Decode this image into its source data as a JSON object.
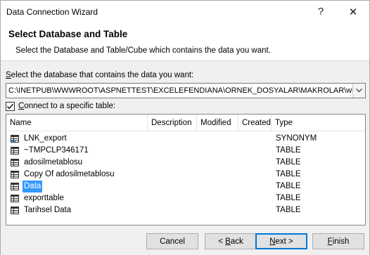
{
  "window": {
    "title": "Data Connection Wizard",
    "help_glyph": "?",
    "close_glyph": "✕"
  },
  "header": {
    "title": "Select Database and Table",
    "subtitle": "Select the Database and Table/Cube which contains the data you want."
  },
  "database": {
    "label_underlined": "S",
    "label_rest": "elect the database that contains the data you want:",
    "value": "C:\\INETPUB\\WWWROOT\\ASPNETTEST\\EXCELEFENDIANA\\ORNEK_DOSYALAR\\MAKROLAR\\wbadb.accdb"
  },
  "connect": {
    "checked": true,
    "label_underlined": "C",
    "label_rest": "onnect to a specific table:"
  },
  "table_list": {
    "columns": [
      "Name",
      "Description",
      "Modified",
      "Created",
      "Type"
    ],
    "rows": [
      {
        "name": "LNK_export",
        "type": "SYNONYM",
        "icon": "synonym-icon",
        "selected": false
      },
      {
        "name": "~TMPCLP346171",
        "type": "TABLE",
        "icon": "table-icon",
        "selected": false
      },
      {
        "name": "adosilmetablosu",
        "type": "TABLE",
        "icon": "table-icon",
        "selected": false
      },
      {
        "name": "Copy Of adosilmetablosu",
        "type": "TABLE",
        "icon": "table-icon",
        "selected": false
      },
      {
        "name": "Data",
        "type": "TABLE",
        "icon": "table-icon",
        "selected": true
      },
      {
        "name": "exporttable",
        "type": "TABLE",
        "icon": "table-icon",
        "selected": false
      },
      {
        "name": "Tarihsel Data",
        "type": "TABLE",
        "icon": "table-icon",
        "selected": false
      }
    ]
  },
  "buttons": {
    "cancel": "Cancel",
    "back_prefix": "< ",
    "back_u": "B",
    "back_rest": "ack",
    "next_u": "N",
    "next_rest": "ext >",
    "finish_u": "F",
    "finish_rest": "inish"
  },
  "colors": {
    "selection": "#3399ff",
    "default_button_border": "#0078d7"
  }
}
